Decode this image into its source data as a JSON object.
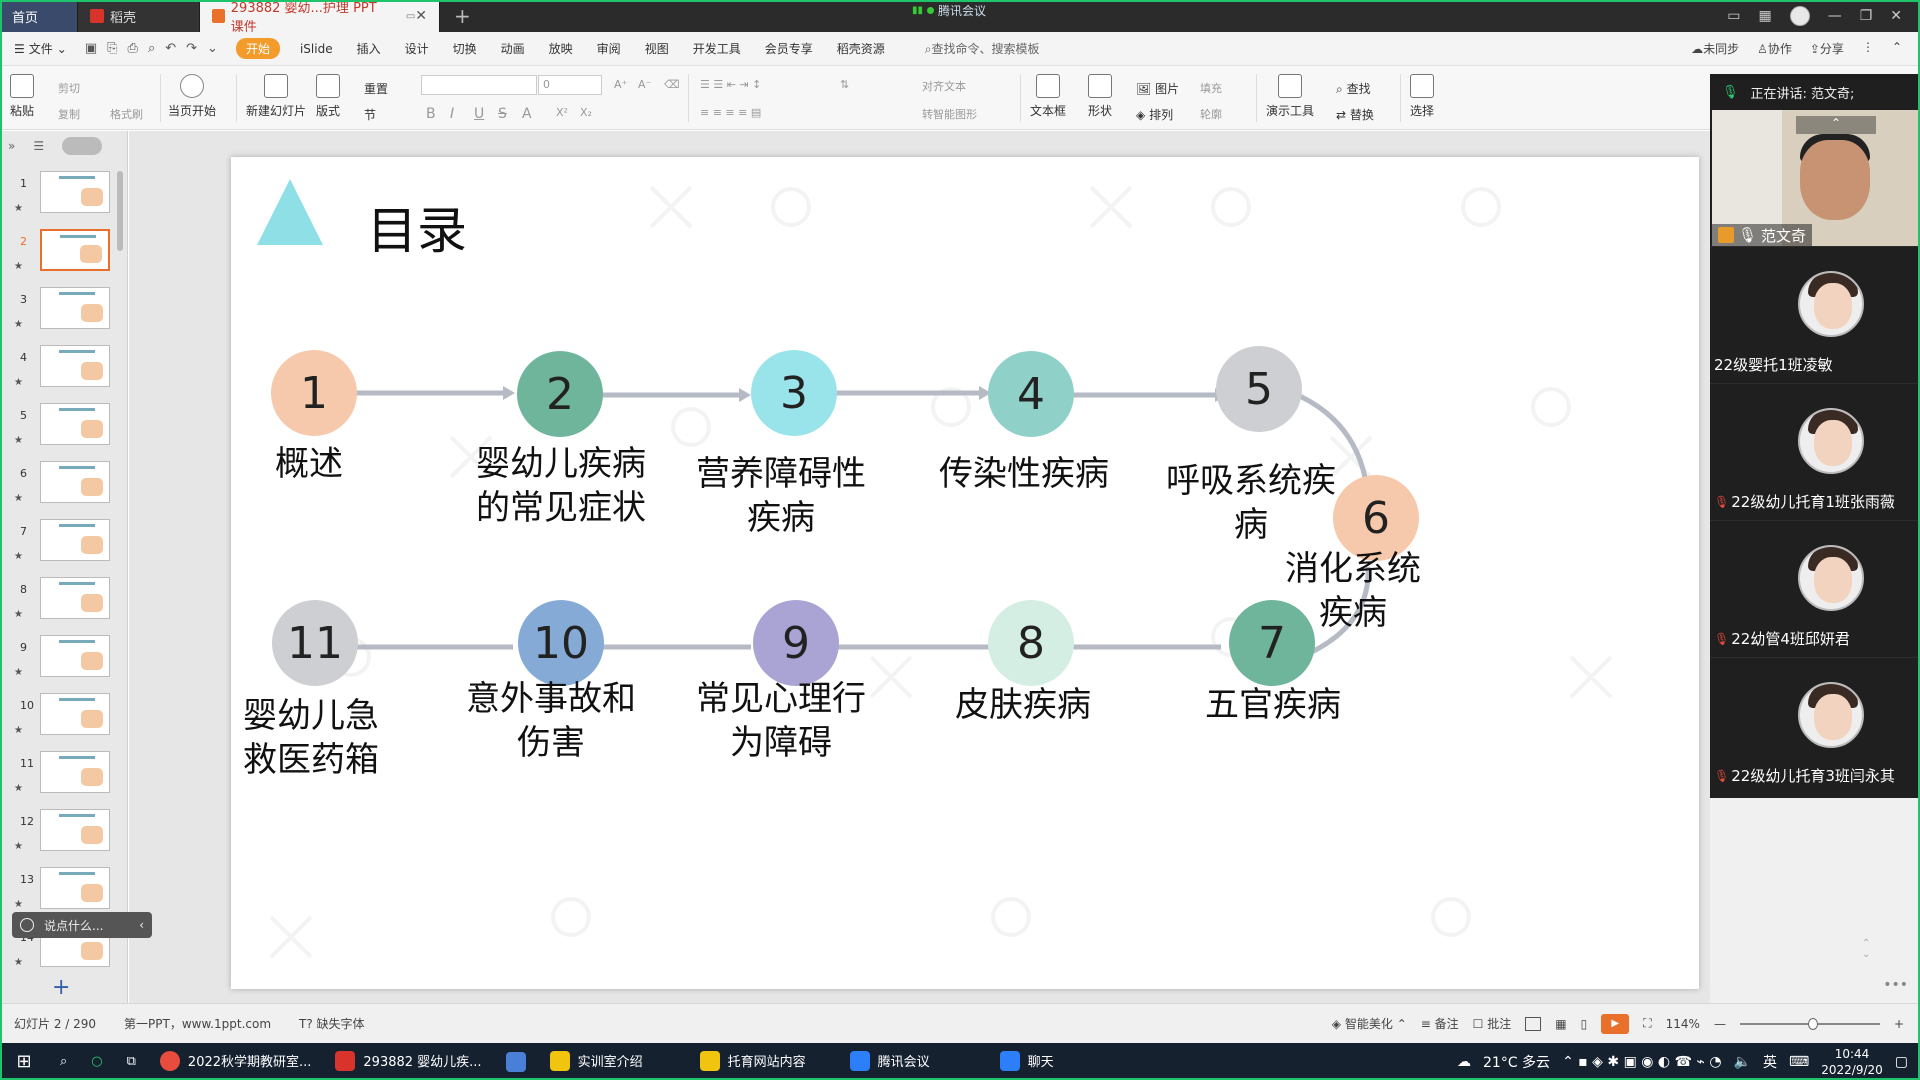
{
  "tabs": {
    "home": "首页",
    "straw": "稻壳",
    "doc": "293882 婴幼...护理  PPT课件",
    "meeting_indicator": "腾讯会议"
  },
  "menu": {
    "file": "文件",
    "items": [
      "开始",
      "iSlide",
      "插入",
      "设计",
      "切换",
      "动画",
      "放映",
      "审阅",
      "视图",
      "开发工具",
      "会员专享",
      "稻壳资源"
    ],
    "search": "查找命令、搜索模板",
    "right": [
      "未同步",
      "协作",
      "分享"
    ]
  },
  "ribbon": {
    "paste": "粘贴",
    "cut": "剪切",
    "copy": "复制",
    "format_painter": "格式刷",
    "play_current": "当页开始",
    "new_slide": "新建幻灯片",
    "layout": "版式",
    "reset": "重置",
    "section": "节",
    "font_size": "0",
    "align_text": "对齐文本",
    "smart_shape": "转智能图形",
    "textbox": "文本框",
    "shape": "形状",
    "picture": "图片",
    "fill": "填充",
    "arrange": "排列",
    "outline": "轮廓",
    "present_tools": "演示工具",
    "find": "查找",
    "replace": "替换",
    "select": "选择"
  },
  "slides_panel": {
    "numbers": [
      "1",
      "2",
      "3",
      "4",
      "5",
      "6",
      "7",
      "8",
      "9",
      "10",
      "11",
      "12",
      "13",
      "14"
    ],
    "active": "2",
    "say_placeholder": "说点什么...",
    "star": "★"
  },
  "slide": {
    "title": "目录",
    "nodes": [
      {
        "num": "1",
        "label": "概述",
        "color": "#f7c9ac"
      },
      {
        "num": "2",
        "label": "婴幼儿疾病\n的常见症状",
        "color": "#6fb59c"
      },
      {
        "num": "3",
        "label": "营养障碍性\n疾病",
        "color": "#99e4ea"
      },
      {
        "num": "4",
        "label": "传染性疾病",
        "color": "#8fd1c8"
      },
      {
        "num": "5",
        "label": "呼吸系统疾病",
        "color": "#cdcfd3"
      },
      {
        "num": "6",
        "label": "消化系统\n疾病",
        "color": "#f7c9ac"
      },
      {
        "num": "7",
        "label": "五官疾病",
        "color": "#6fb59c"
      },
      {
        "num": "8",
        "label": "皮肤疾病",
        "color": "#d5eee4"
      },
      {
        "num": "9",
        "label": "常见心理行\n为障碍",
        "color": "#a9a4d3"
      },
      {
        "num": "10",
        "label": "意外事故和\n伤害",
        "color": "#86aad6"
      },
      {
        "num": "11",
        "label": "婴幼儿急\n救医药箱",
        "color": "#cdcfd3"
      }
    ]
  },
  "meeting": {
    "speaking": "正在讲话: 范文奇;",
    "host": "范文奇",
    "participants": [
      "22级婴托1班凌敏",
      "22级幼儿托育1班张雨薇",
      "22幼管4班邱妍君",
      "22级幼儿托育3班闫永其"
    ]
  },
  "status": {
    "slide_count": "幻灯片 2 / 290",
    "theme": "第一PPT，www.1ppt.com",
    "missing_font": "缺失字体",
    "beautify": "智能美化",
    "notes": "备注",
    "comments": "批注",
    "zoom": "114%"
  },
  "taskbar": {
    "apps": [
      "2022秋学期教研室...",
      "293882 婴幼儿疾...",
      "实训室介绍",
      "托育网站内容",
      "腾讯会议",
      "聊天"
    ],
    "weather": "21°C  多云",
    "ime": "英",
    "time": "10:44",
    "date": "2022/9/20"
  },
  "colors": {
    "accent": "#e8702a",
    "connector": "#b5bac4",
    "triangle": "#8fe0e6"
  }
}
